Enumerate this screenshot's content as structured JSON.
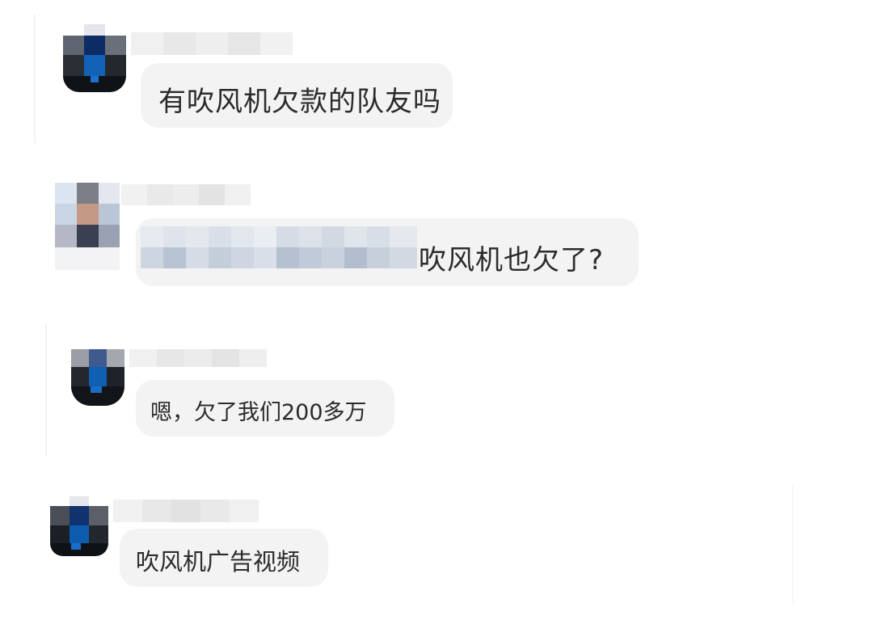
{
  "comments": [
    {
      "text": "有吹风机欠款的队友吗"
    },
    {
      "text": "吹风机也欠了?"
    },
    {
      "text": "嗯，欠了我们200多万"
    },
    {
      "text": "吹风机广告视频"
    }
  ],
  "colors": {
    "bubble": "#f3f3f3",
    "text": "#2b2b2b",
    "avatar_blue": "#0b5aa8",
    "avatar_dark": "#1a1f26"
  }
}
